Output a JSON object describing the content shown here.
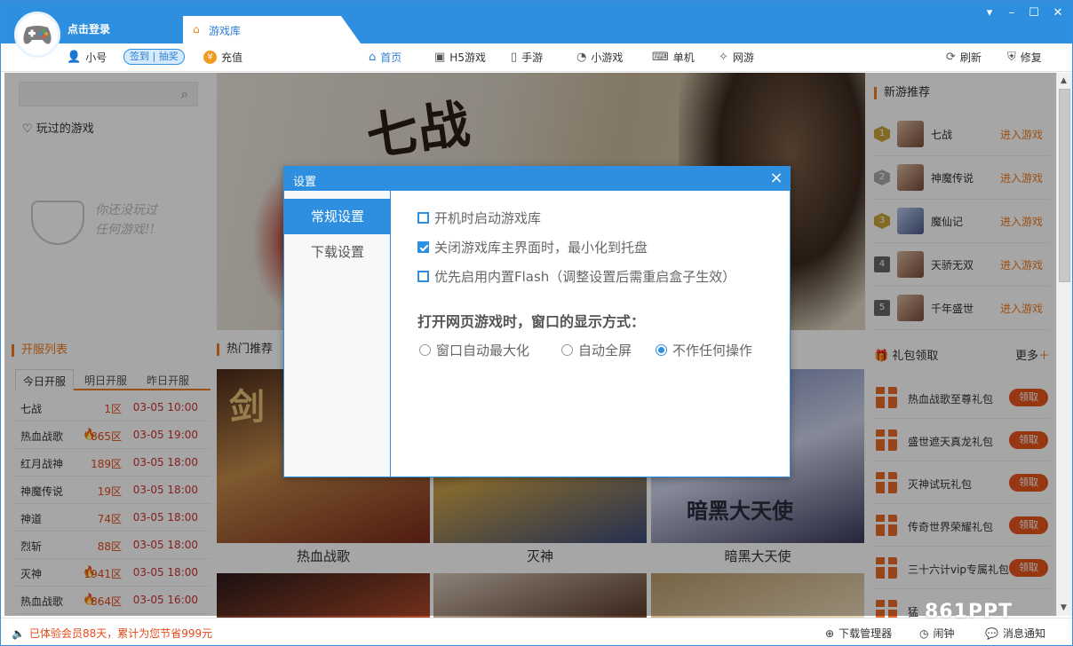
{
  "titlebar": {
    "login_text": "点击登录",
    "active_tab": "游戏库"
  },
  "toolbar": {
    "account": "小号",
    "signin": "签到 | 抽奖",
    "recharge": "充值",
    "nav": [
      "首页",
      "H5游戏",
      "手游",
      "小游戏",
      "单机",
      "网游"
    ],
    "refresh": "刷新",
    "repair": "修复"
  },
  "left": {
    "played_label": "玩过的游戏",
    "empty_text_1": "你还没玩过",
    "empty_text_2": "任何游戏!!",
    "open_server_title": "开服列表",
    "server_tabs": [
      "今日开服",
      "明日开服",
      "昨日开服"
    ],
    "servers": [
      {
        "name": "七战",
        "fire": "",
        "zone": "1区",
        "time": "03-05 10:00"
      },
      {
        "name": "热血战歌",
        "fire": "🔥",
        "zone": "865区",
        "time": "03-05 19:00"
      },
      {
        "name": "红月战神",
        "fire": "",
        "zone": "189区",
        "time": "03-05 18:00"
      },
      {
        "name": "神魔传说",
        "fire": "",
        "zone": "19区",
        "time": "03-05 18:00"
      },
      {
        "name": "神道",
        "fire": "",
        "zone": "74区",
        "time": "03-05 18:00"
      },
      {
        "name": "烈斩",
        "fire": "",
        "zone": "88区",
        "time": "03-05 18:00"
      },
      {
        "name": "灭神",
        "fire": "🔥",
        "zone": "1941区",
        "time": "03-05 18:00"
      },
      {
        "name": "热血战歌",
        "fire": "🔥",
        "zone": "864区",
        "time": "03-05 16:00"
      }
    ]
  },
  "center": {
    "banner_logo": "七战",
    "hot_title": "热门推荐",
    "games": [
      "热血战歌",
      "灭神",
      "暗黑大天使"
    ],
    "card_art_text": [
      "剑",
      "",
      "暗黑大天使"
    ]
  },
  "right": {
    "new_title": "新游推荐",
    "new_games": [
      {
        "rank": "1",
        "name": "七战",
        "action": "进入游戏"
      },
      {
        "rank": "2",
        "name": "神魔传说",
        "action": "进入游戏"
      },
      {
        "rank": "3",
        "name": "魔仙记",
        "action": "进入游戏"
      },
      {
        "rank": "4",
        "name": "天骄无双",
        "action": "进入游戏"
      },
      {
        "rank": "5",
        "name": "千年盛世",
        "action": "进入游戏"
      }
    ],
    "gift_title": "礼包领取",
    "more": "更多",
    "gifts": [
      {
        "name": "热血战歌至尊礼包",
        "btn": "领取"
      },
      {
        "name": "盛世遮天真龙礼包",
        "btn": "领取"
      },
      {
        "name": "灭神试玩礼包",
        "btn": "领取"
      },
      {
        "name": "传奇世界荣耀礼包",
        "btn": "领取"
      },
      {
        "name": "三十六计vip专属礼包",
        "btn": "领取"
      },
      {
        "name": "猛",
        "btn": ""
      }
    ]
  },
  "dialog": {
    "title": "设置",
    "tabs": [
      "常规设置",
      "下载设置"
    ],
    "options": [
      {
        "label": "开机时启动游戏库",
        "checked": false
      },
      {
        "label": "关闭游戏库主界面时，最小化到托盘",
        "checked": true
      },
      {
        "label": "优先启用内置Flash（调整设置后需重启盒子生效）",
        "checked": false
      }
    ],
    "display_title": "打开网页游戏时，窗口的显示方式：",
    "radios": [
      {
        "label": "窗口自动最大化",
        "selected": false
      },
      {
        "label": "自动全屏",
        "selected": false
      },
      {
        "label": "不作任何操作",
        "selected": true
      }
    ]
  },
  "statusbar": {
    "member_text": "已体验会员88天，累计为您节省999元",
    "download_manager": "下载管理器",
    "alarm": "闹钟",
    "notify": "消息通知"
  },
  "watermark": "861PPT",
  "colors": {
    "primary": "#2e8fe0",
    "accent": "#f07b1e",
    "danger": "#e8541e"
  }
}
